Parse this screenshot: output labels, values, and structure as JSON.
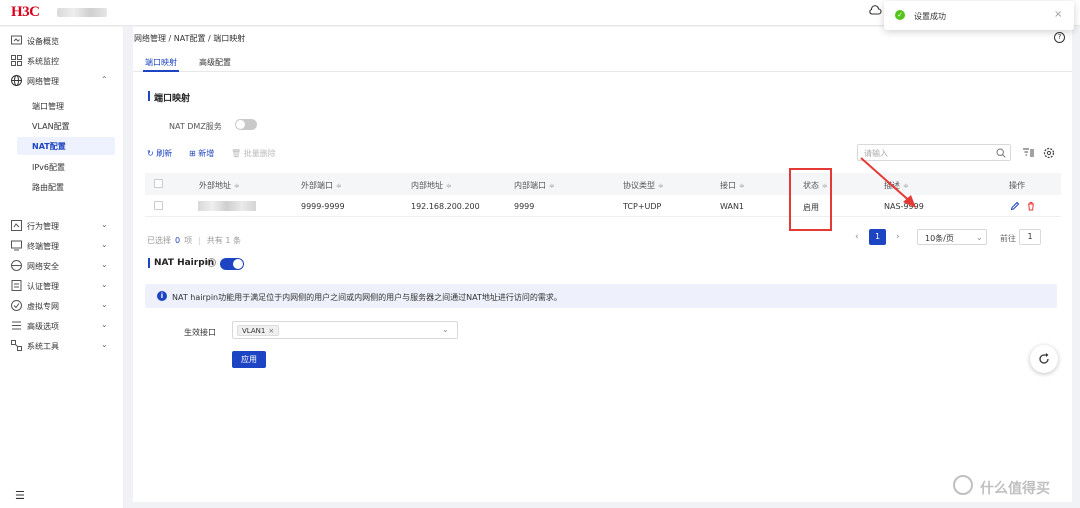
{
  "brand": {
    "logo_text": "H3C"
  },
  "toast": {
    "message": "设置成功",
    "close": "×"
  },
  "sidebar": {
    "items": [
      {
        "label": "设备概览",
        "icon": "dashboard-icon"
      },
      {
        "label": "系统监控",
        "icon": "monitor-icon"
      },
      {
        "label": "网络管理",
        "icon": "globe-icon",
        "expanded": true
      },
      {
        "label": "行为管理",
        "icon": "behavior-icon"
      },
      {
        "label": "终端管理",
        "icon": "terminal-icon"
      },
      {
        "label": "网络安全",
        "icon": "security-icon"
      },
      {
        "label": "认证管理",
        "icon": "auth-icon"
      },
      {
        "label": "虚拟专网",
        "icon": "vpn-icon"
      },
      {
        "label": "高级选项",
        "icon": "advanced-icon"
      },
      {
        "label": "系统工具",
        "icon": "tools-icon"
      }
    ],
    "subitems": [
      "端口管理",
      "VLAN配置",
      "NAT配置",
      "IPv6配置",
      "路由配置"
    ],
    "active_sub": "NAT配置",
    "chev_up": "⌃",
    "chev_down": "⌄",
    "menu_toggle": "☰"
  },
  "breadcrumb": "网络管理 / NAT配置 / 端口映射",
  "help": "?",
  "tabs": [
    "端口映射",
    "高级配置"
  ],
  "port_mapping": {
    "title": "端口映射",
    "dmz_label": "NAT DMZ服务",
    "dmz_enabled": false,
    "toolbar": {
      "refresh": "刷新",
      "add": "新增",
      "batch_delete": "批量删除"
    },
    "search_placeholder": "请输入",
    "columns": [
      "外部地址",
      "外部端口",
      "内部地址",
      "内部端口",
      "协议类型",
      "接口",
      "状态",
      "描述",
      "操作"
    ],
    "sort_glyph": "≑",
    "rows": [
      {
        "ext_port": "9999-9999",
        "int_addr": "192.168.200.200",
        "int_port": "9999",
        "protocol": "TCP+UDP",
        "interface": "WAN1",
        "status": "启用",
        "desc": "NAS-9999"
      }
    ],
    "selected_prefix": "已选择",
    "selected_count": "0",
    "selected_unit": "项",
    "total_text": "共有 1 条",
    "page_current": "1",
    "page_size": "10条/页",
    "goto_label": "前往",
    "goto_value": "1",
    "prev": "‹",
    "next": "›",
    "size_chev": "⌄"
  },
  "hairpin": {
    "title": "NAT Hairpin",
    "enabled": true,
    "info_icon": "i",
    "info": "NAT hairpin功能用于满足位于内网侧的用户之间或内网侧的用户与服务器之间通过NAT地址进行访问的需求。",
    "interface_label": "生效接口",
    "interface_tag": "VLAN1",
    "tag_close": "×",
    "select_chev": "⌄",
    "apply": "应用"
  },
  "watermark": "什么值得买",
  "colors": {
    "accent": "#1d44c2",
    "brand": "#d9001b",
    "highlight": "#e53935",
    "success": "#52c41a"
  }
}
